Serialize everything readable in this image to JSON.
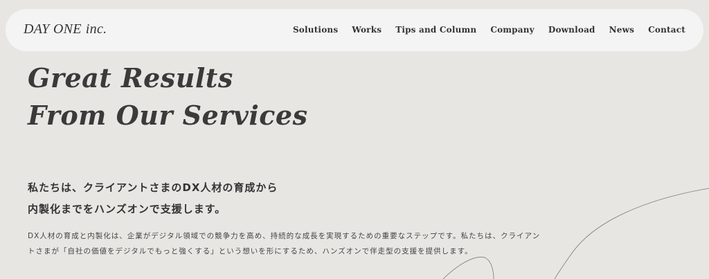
{
  "header": {
    "logo_main": "DAY ONE",
    "logo_suffix": "inc.",
    "nav": [
      {
        "label": "Solutions"
      },
      {
        "label": "Works"
      },
      {
        "label": "Tips and Column"
      },
      {
        "label": "Company"
      },
      {
        "label": "Download"
      },
      {
        "label": "News"
      },
      {
        "label": "Contact"
      }
    ]
  },
  "hero": {
    "headline_line1": "Great Results",
    "headline_line2": "From Our Services",
    "lead_line1": "私たちは、クライアントさまのDX人材の育成から",
    "lead_line2": "内製化までをハンズオンで支援します。",
    "body_line1": "DX人材の育成と内製化は、企業がデジタル領域での競争力を高め、持続的な成長を実現するための重要なステップです。私たちは、クライアン",
    "body_line2": "トさまが「自社の価値をデジタルでもっと強くする」という想いを形にするため、ハンズオンで伴走型の支援を提供します。"
  },
  "colors": {
    "background": "#e8e6e3",
    "header_bg": "#f4f4f4",
    "text": "#333333"
  }
}
